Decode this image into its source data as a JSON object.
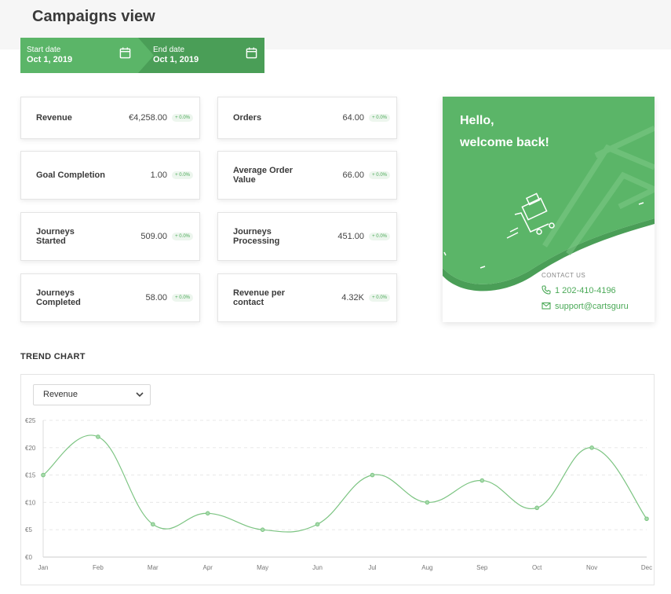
{
  "page": {
    "title": "Campaigns view"
  },
  "dates": {
    "start": {
      "label": "Start date",
      "value": "Oct 1, 2019"
    },
    "end": {
      "label": "End date",
      "value": "Oct 1, 2019"
    }
  },
  "metrics": [
    {
      "name": "Revenue",
      "value": "€4,258.00",
      "change": "+ 0.0%"
    },
    {
      "name": "Orders",
      "value": "64.00",
      "change": "+ 0.0%"
    },
    {
      "name": "Goal Completion",
      "value": "1.00",
      "change": "+ 0.0%"
    },
    {
      "name": "Average Order Value",
      "value": "66.00",
      "change": "+ 0.0%"
    },
    {
      "name": "Journeys Started",
      "value": "509.00",
      "change": "+ 0.0%"
    },
    {
      "name": "Journeys Processing",
      "value": "451.00",
      "change": "+ 0.0%"
    },
    {
      "name": "Journeys Completed",
      "value": "58.00",
      "change": "+ 0.0%"
    },
    {
      "name": "Revenue per contact",
      "value": "4.32K",
      "change": "+ 0.0%"
    }
  ],
  "welcome": {
    "line1": "Hello,",
    "line2": "welcome back!",
    "contact_label": "CONTACT US",
    "phone": "1 202-410-4196",
    "email": "support@cartsguru"
  },
  "trend": {
    "title": "TREND CHART",
    "selected_metric": "Revenue"
  },
  "colors": {
    "brand_green": "#5bb568",
    "dark_green": "#4a9e57",
    "line": "#7cc482"
  },
  "chart_data": {
    "type": "line",
    "categories": [
      "Jan",
      "Feb",
      "Mar",
      "Apr",
      "May",
      "Jun",
      "Jul",
      "Aug",
      "Sep",
      "Oct",
      "Nov",
      "Dec"
    ],
    "series": [
      {
        "values": [
          15,
          22,
          6,
          8,
          5,
          6,
          15,
          10,
          14,
          9,
          20,
          7
        ]
      }
    ],
    "yticks": [
      "€0",
      "€5",
      "€10",
      "€15",
      "€20",
      "€25"
    ],
    "ylim": [
      0,
      25
    ],
    "grid": true,
    "title": "",
    "xlabel": "",
    "ylabel": ""
  }
}
